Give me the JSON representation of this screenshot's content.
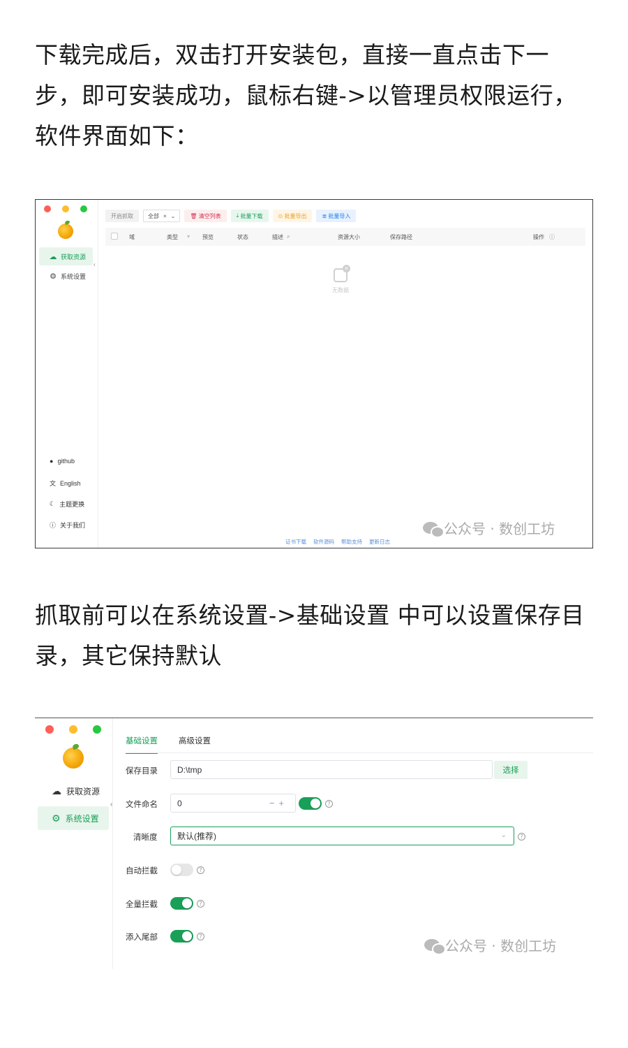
{
  "paragraph1": {
    "line1": "下载完成后，双击打开安装包，直接一直点击下一",
    "line2": "步，即可安装成功，鼠标右键->以管理员权限运行，",
    "line3": "软件界面如下："
  },
  "paragraph2": {
    "line1": "抓取前可以在系统设置->基础设置 中可以设置保存目",
    "line2": "录，其它保持默认"
  },
  "shot1": {
    "sidebar": {
      "nav": [
        "获取资源",
        "系统设置"
      ],
      "bottom": [
        "github",
        "English",
        "主题更换",
        "关于我们"
      ]
    },
    "toolbar": {
      "start_capture": "开启抓取",
      "filter_select": "全部",
      "clear_list": "清空列表",
      "batch_download": "批量下载",
      "batch_export": "批量导出",
      "batch_import": "批量导入"
    },
    "table_headers": [
      "域",
      "类型",
      "预览",
      "状态",
      "描述",
      "资源大小",
      "保存路径",
      "操作"
    ],
    "empty_text": "无数据",
    "footer_links": [
      "证书下载",
      "软件源码",
      "帮助支持",
      "更新日志"
    ]
  },
  "shot2": {
    "sidebar": {
      "nav": [
        "获取资源",
        "系统设置"
      ]
    },
    "tabs": [
      "基础设置",
      "高级设置"
    ],
    "fields": {
      "save_dir_label": "保存目录",
      "save_dir_value": "D:\\tmp",
      "choose_button": "选择",
      "file_naming_label": "文件命名",
      "file_naming_value": "0",
      "file_naming_toggle": true,
      "quality_label": "清晰度",
      "quality_value": "默认(推荐)",
      "auto_intercept_label": "自动拦截",
      "auto_intercept": false,
      "full_intercept_label": "全量拦截",
      "full_intercept": true,
      "insert_tail_label": "添入尾部",
      "insert_tail": true
    }
  },
  "watermark": "公众号 · 数创工坊",
  "colors": {
    "accent_green": "#18a058",
    "danger_red": "#d03050",
    "warning_orange": "#f0a020",
    "info_blue": "#2080f0"
  }
}
